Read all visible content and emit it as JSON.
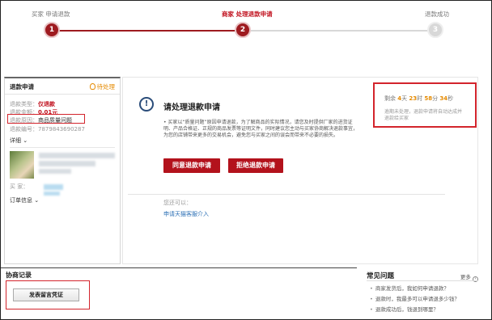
{
  "steps": [
    {
      "label": "买家 申请退款",
      "number": "1",
      "state": "done"
    },
    {
      "label": "商家 处理退款申请",
      "number": "2",
      "state": "current"
    },
    {
      "label": "退款成功",
      "number": "3",
      "state": "todo"
    }
  ],
  "refund": {
    "title": "退款申请",
    "status": "待处理",
    "type_label": "退款类型：",
    "type_value": "仅退款",
    "amount_label": "退款金额：",
    "amount_value": "0.01元",
    "reason_label": "退款原因：",
    "reason_value": "商品质量问题",
    "number_label": "退款编号：",
    "number_value": "7879843690287",
    "detail": "详细",
    "buyer_label": "买    家：",
    "order_info": "订单信息"
  },
  "main": {
    "title": "请处理退款申请",
    "description": "买家以“质量问题”原因申请退款，为了解商品的实际情况，请您及时提供厂家的进货证明、产品合格证、正规的商品发票等证明文件，同时建议您主动与买家协商解决退款事宜，为您的店铺带来更多的交易机会，避免您与买家之间的误会而带来不必要的损失。",
    "agree_button": "同意退款申请",
    "reject_button": "拒绝退款申请",
    "can_label": "您还可以：",
    "intervene_link": "申请天猫客服介入"
  },
  "countdown": {
    "prefix": "剩余",
    "days": "4",
    "days_unit": "天",
    "hours": "23",
    "hours_unit": "时",
    "minutes": "58",
    "minutes_unit": "分",
    "seconds": "34",
    "seconds_unit": "秒",
    "note": "逾期未处理，退款申请将自动达成并退款给买家"
  },
  "negotiation": {
    "title": "协商记录",
    "button": "发表留言凭证"
  },
  "faq": {
    "title": "常见问题",
    "more": "更多",
    "items": [
      "商家发货后，我如何申请退款？",
      "退款时，我最多可以申请退多少钱？",
      "退款成功后，钱退到哪里？"
    ]
  },
  "colors": {
    "accent_red": "#b3121c",
    "highlight_red": "#d3242c",
    "pending_orange": "#e58a00",
    "link_blue": "#2a6fb5"
  }
}
